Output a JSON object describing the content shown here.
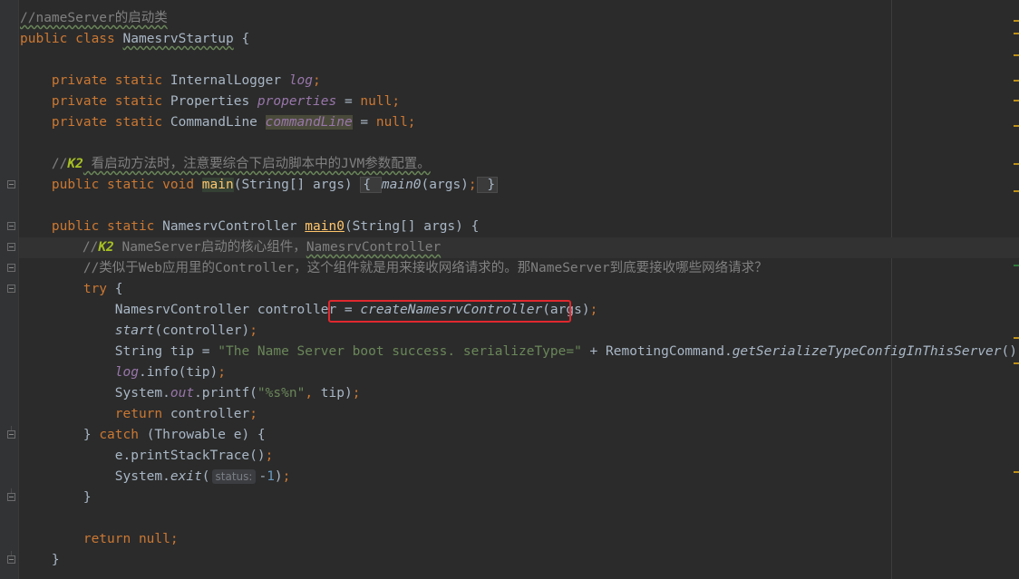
{
  "editor": {
    "lines": [
      {
        "parts": [
          {
            "t": "//nameServer的启动类",
            "c": "cm wavy"
          }
        ]
      },
      {
        "parts": [
          {
            "t": "public class ",
            "c": "kw"
          },
          {
            "t": "NamesrvStartup",
            "c": "wavy"
          },
          {
            "t": " {",
            "c": ""
          }
        ]
      },
      {
        "parts": []
      },
      {
        "parts": [
          {
            "t": "    private static ",
            "c": "kw"
          },
          {
            "t": "InternalLogger ",
            "c": ""
          },
          {
            "t": "log",
            "c": "field"
          },
          {
            "t": ";",
            "c": "kw"
          }
        ]
      },
      {
        "parts": [
          {
            "t": "    private static ",
            "c": "kw"
          },
          {
            "t": "Properties ",
            "c": ""
          },
          {
            "t": "properties",
            "c": "field"
          },
          {
            "t": " = ",
            "c": ""
          },
          {
            "t": "null",
            "c": "kw"
          },
          {
            "t": ";",
            "c": "kw"
          }
        ]
      },
      {
        "parts": [
          {
            "t": "    private static ",
            "c": "kw"
          },
          {
            "t": "CommandLine ",
            "c": ""
          },
          {
            "t": "commandLine",
            "c": "field unused-bg"
          },
          {
            "t": " = ",
            "c": ""
          },
          {
            "t": "null",
            "c": "kw"
          },
          {
            "t": ";",
            "c": "kw"
          }
        ]
      },
      {
        "parts": []
      },
      {
        "parts": [
          {
            "t": "    //",
            "c": "cm"
          },
          {
            "t": "K2",
            "c": "todo"
          },
          {
            "t": " 看启动方法时，注意要综合下启动脚本中的JVM参数配置。",
            "c": "cm wavy"
          }
        ]
      },
      {
        "parts": [
          {
            "t": "    public static void ",
            "c": "kw"
          },
          {
            "t": "main",
            "c": "mth-main"
          },
          {
            "t": "(String[] args) ",
            "c": ""
          },
          {
            "t": "{ ",
            "c": "fold-brace"
          },
          {
            "t": "main0",
            "c": "call"
          },
          {
            "t": "(args)",
            "c": ""
          },
          {
            "t": ";",
            "c": "kw"
          },
          {
            "t": " }",
            "c": "fold-brace"
          }
        ]
      },
      {
        "parts": []
      },
      {
        "parts": [
          {
            "t": "    public static ",
            "c": "kw"
          },
          {
            "t": "NamesrvController ",
            "c": ""
          },
          {
            "t": "main0",
            "c": "mth-under"
          },
          {
            "t": "(String[] args) {",
            "c": ""
          }
        ]
      },
      {
        "parts": [
          {
            "t": "        //",
            "c": "cm"
          },
          {
            "t": "K2",
            "c": "todo"
          },
          {
            "t": " NameServer启动的核心组件，",
            "c": "cm"
          },
          {
            "t": "NamesrvController",
            "c": "cm wavy"
          }
        ],
        "current": true
      },
      {
        "parts": [
          {
            "t": "        //类似于Web应用里的Controller，这个组件就是用来接收网络请求的。那NameServer到底要接收哪些网络请求？",
            "c": "cm"
          }
        ]
      },
      {
        "parts": [
          {
            "t": "        try ",
            "c": "kw"
          },
          {
            "t": "{",
            "c": ""
          }
        ]
      },
      {
        "parts": [
          {
            "t": "            NamesrvController controller = ",
            "c": ""
          },
          {
            "t": "createNamesrvController",
            "c": "call"
          },
          {
            "t": "(args)",
            "c": ""
          },
          {
            "t": ";",
            "c": "kw"
          }
        ]
      },
      {
        "parts": [
          {
            "t": "            ",
            "c": ""
          },
          {
            "t": "start",
            "c": "call"
          },
          {
            "t": "(controller)",
            "c": ""
          },
          {
            "t": ";",
            "c": "kw"
          }
        ]
      },
      {
        "parts": [
          {
            "t": "            String tip = ",
            "c": ""
          },
          {
            "t": "\"The Name Server boot success. serializeType=\"",
            "c": "str"
          },
          {
            "t": " + RemotingCommand.",
            "c": ""
          },
          {
            "t": "getSerializeTypeConfigInThisServer",
            "c": "call"
          },
          {
            "t": "()",
            "c": ""
          },
          {
            "t": ";",
            "c": "kw"
          }
        ]
      },
      {
        "parts": [
          {
            "t": "            ",
            "c": ""
          },
          {
            "t": "log",
            "c": "field"
          },
          {
            "t": ".info(tip)",
            "c": ""
          },
          {
            "t": ";",
            "c": "kw"
          }
        ]
      },
      {
        "parts": [
          {
            "t": "            System.",
            "c": ""
          },
          {
            "t": "out",
            "c": "field"
          },
          {
            "t": ".printf(",
            "c": ""
          },
          {
            "t": "\"%s%n\"",
            "c": "str"
          },
          {
            "t": ", ",
            "c": "kw"
          },
          {
            "t": "tip)",
            "c": ""
          },
          {
            "t": ";",
            "c": "kw"
          }
        ]
      },
      {
        "parts": [
          {
            "t": "            return ",
            "c": "kw"
          },
          {
            "t": "controller",
            "c": ""
          },
          {
            "t": ";",
            "c": "kw"
          }
        ]
      },
      {
        "parts": [
          {
            "t": "        } ",
            "c": ""
          },
          {
            "t": "catch ",
            "c": "kw"
          },
          {
            "t": "(Throwable e) {",
            "c": ""
          }
        ]
      },
      {
        "parts": [
          {
            "t": "            e.printStackTrace()",
            "c": ""
          },
          {
            "t": ";",
            "c": "kw"
          }
        ]
      },
      {
        "parts": [
          {
            "t": "            System.",
            "c": ""
          },
          {
            "t": "exit",
            "c": "call"
          },
          {
            "t": "(",
            "c": ""
          },
          {
            "t": "status:",
            "c": "hint"
          },
          {
            "t": "-",
            "c": ""
          },
          {
            "t": "1",
            "c": "num"
          },
          {
            "t": ")",
            "c": ""
          },
          {
            "t": ";",
            "c": "kw"
          }
        ]
      },
      {
        "parts": [
          {
            "t": "        }",
            "c": ""
          }
        ]
      },
      {
        "parts": []
      },
      {
        "parts": [
          {
            "t": "        return null",
            "c": "kw"
          },
          {
            "t": ";",
            "c": "kw"
          }
        ]
      },
      {
        "parts": [
          {
            "t": "    }",
            "c": ""
          }
        ]
      }
    ]
  },
  "colors": {
    "background": "#2b2b2b",
    "keyword": "#cc7832",
    "comment": "#808080",
    "string": "#6a8759",
    "field": "#9876aa",
    "method": "#ffc66d",
    "highlight_box": "#e0282e"
  }
}
